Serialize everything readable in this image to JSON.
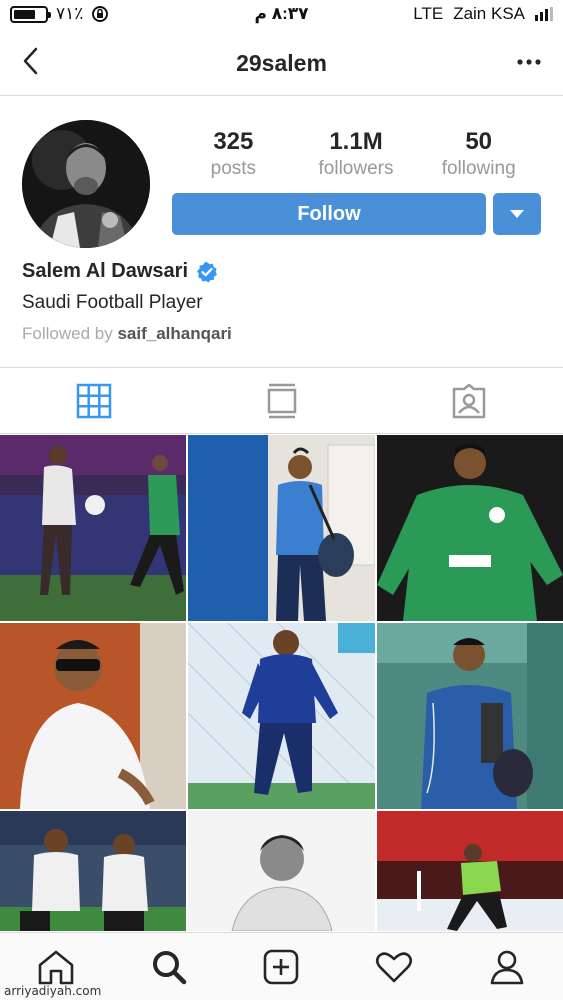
{
  "status_bar": {
    "battery_percent": "٧١٪",
    "time": "٨:٣٧ م",
    "network": "LTE",
    "carrier": "Zain KSA"
  },
  "nav": {
    "username": "29salem",
    "back_icon": "chevron-left-icon",
    "more_icon": "more-horizontal-icon"
  },
  "profile": {
    "posts_count": "325",
    "posts_label": "posts",
    "followers_count": "1.1M",
    "followers_label": "followers",
    "following_count": "50",
    "following_label": "following",
    "follow_label": "Follow",
    "name": "Salem Al Dawsari",
    "verified": true,
    "bio": "Saudi Football Player",
    "followed_by_prefix": "Followed by",
    "followed_by_user": "saif_alhanqari"
  },
  "tabs": [
    "grid-icon",
    "feed-icon",
    "tagged-icon"
  ],
  "bottom_nav": [
    "home-icon",
    "search-icon",
    "add-post-icon",
    "heart-icon",
    "profile-icon"
  ],
  "watermark": "arriyadiyah.com",
  "colors": {
    "accent": "#4a90d9",
    "verified": "#3897f0",
    "active_tab": "#3897f0"
  }
}
